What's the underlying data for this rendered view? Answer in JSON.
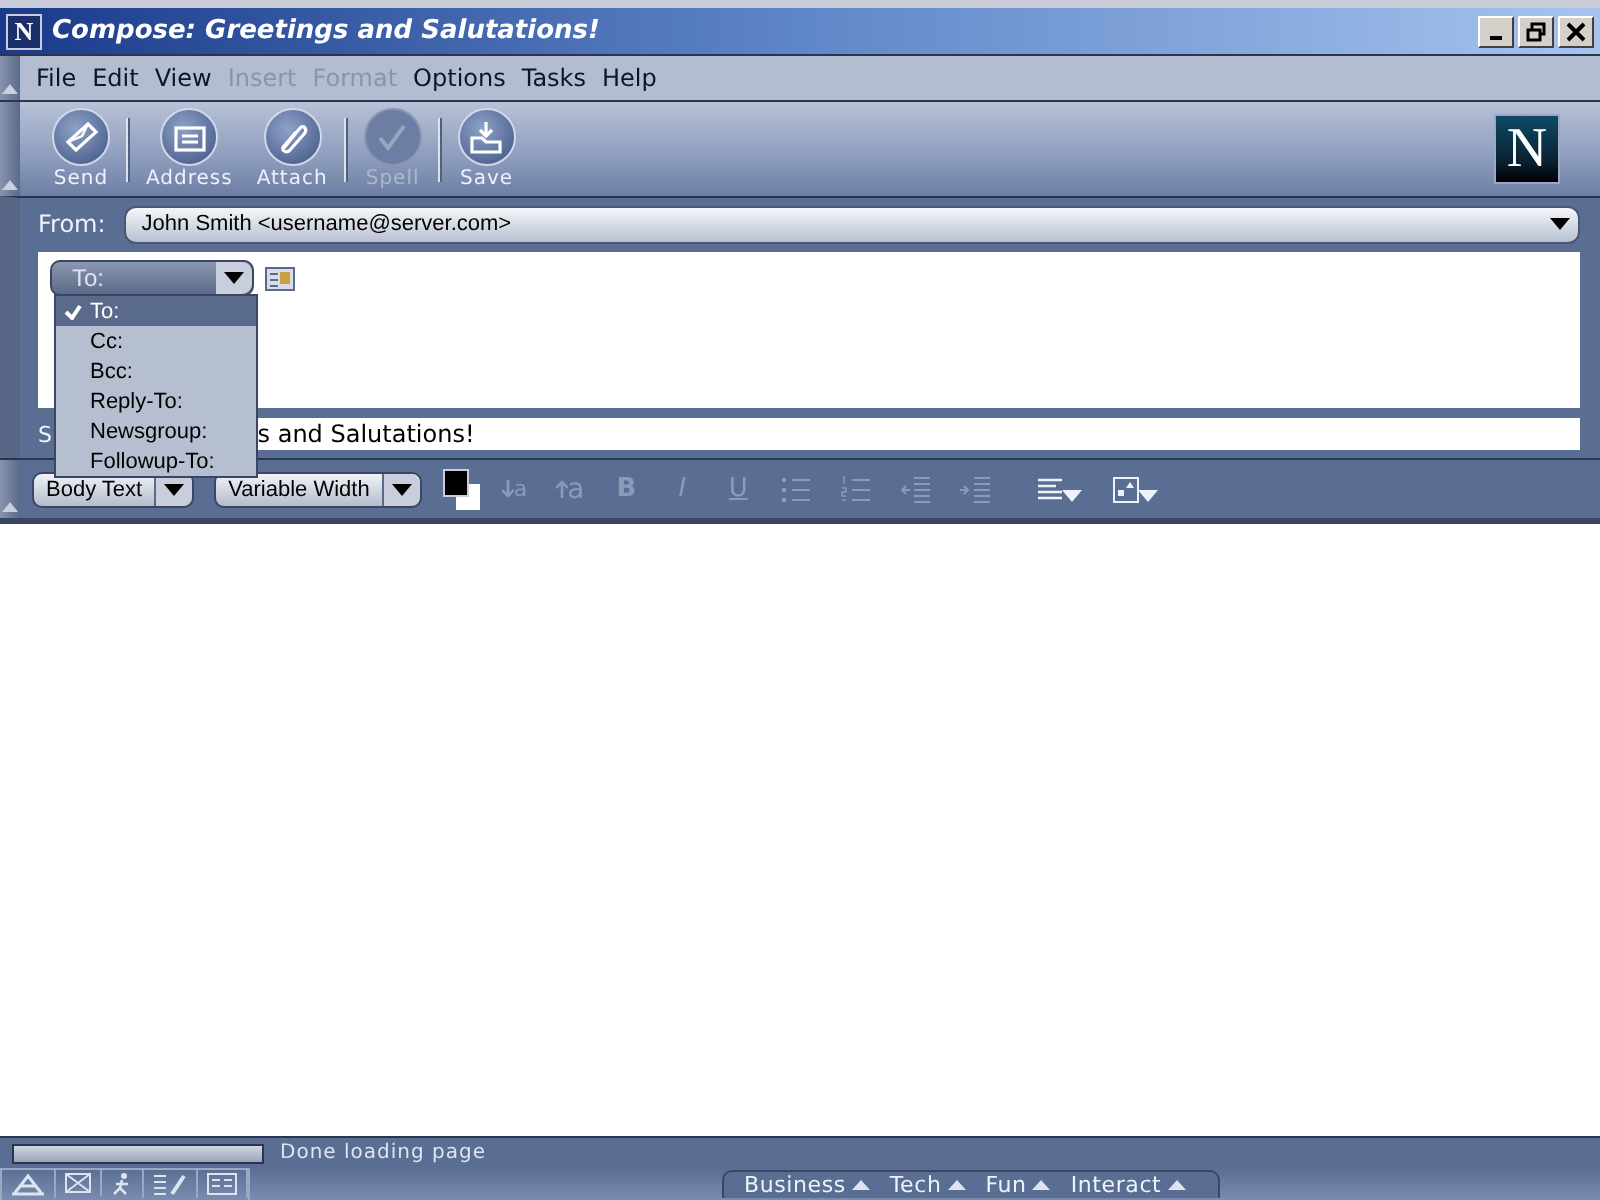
{
  "window": {
    "title": "Compose: Greetings and Salutations!",
    "app_letter": "N"
  },
  "menu": [
    {
      "label": "File",
      "disabled": false
    },
    {
      "label": "Edit",
      "disabled": false
    },
    {
      "label": "View",
      "disabled": false
    },
    {
      "label": "Insert",
      "disabled": true
    },
    {
      "label": "Format",
      "disabled": true
    },
    {
      "label": "Options",
      "disabled": false
    },
    {
      "label": "Tasks",
      "disabled": false
    },
    {
      "label": "Help",
      "disabled": false
    }
  ],
  "toolbar": {
    "buttons": [
      {
        "label": "Send",
        "kind": "send",
        "disabled": false
      },
      {
        "label": "Address",
        "kind": "address",
        "disabled": false
      },
      {
        "label": "Attach",
        "kind": "attach",
        "disabled": false
      },
      {
        "label": "Spell",
        "kind": "spell",
        "disabled": true
      },
      {
        "label": "Save",
        "kind": "save",
        "disabled": false
      }
    ],
    "logo": "N"
  },
  "from": {
    "label": "From:",
    "value": "John Smith <username@server.com>"
  },
  "address": {
    "field_type": "To:",
    "options": [
      {
        "label": "To:",
        "selected": true
      },
      {
        "label": "Cc:",
        "selected": false
      },
      {
        "label": "Bcc:",
        "selected": false
      },
      {
        "label": "Reply-To:",
        "selected": false
      },
      {
        "label": "Newsgroup:",
        "selected": false
      },
      {
        "label": "Followup-To:",
        "selected": false
      }
    ]
  },
  "subject": {
    "label": "S",
    "value": "s and Salutations!"
  },
  "format_bar": {
    "paragraph_style": "Body Text",
    "font": "Variable Width",
    "tools": [
      {
        "kind": "smaller",
        "label": "a",
        "disabled": true
      },
      {
        "kind": "larger",
        "label": "a",
        "disabled": true
      },
      {
        "kind": "letter",
        "label": "B",
        "disabled": true
      },
      {
        "kind": "letter",
        "label": "I",
        "disabled": true
      },
      {
        "kind": "letter",
        "label": "U",
        "disabled": true
      },
      {
        "kind": "bullets",
        "disabled": true
      },
      {
        "kind": "numbers",
        "disabled": true
      },
      {
        "kind": "outdent",
        "disabled": true
      },
      {
        "kind": "indent",
        "disabled": true
      },
      {
        "kind": "align",
        "disabled": false
      },
      {
        "kind": "insert",
        "disabled": false
      }
    ]
  },
  "status": {
    "text": "Done loading page",
    "progress": {
      "level": 1
    }
  },
  "taskbar": {
    "tabs": [
      {
        "label": "Business"
      },
      {
        "label": "Tech"
      },
      {
        "label": "Fun"
      },
      {
        "label": "Interact"
      }
    ]
  }
}
